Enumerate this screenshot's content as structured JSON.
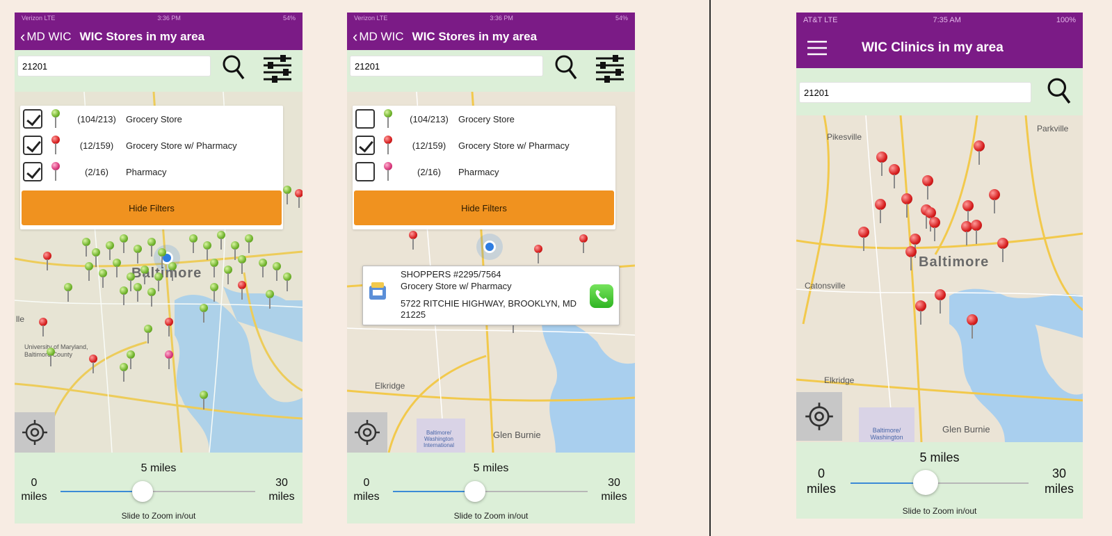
{
  "phone1": {
    "status": {
      "carrier": "Verizon LTE",
      "time": "3:36 PM",
      "battery": "54%"
    },
    "nav": {
      "back_label": "MD WIC",
      "title": "WIC Stores in my area"
    },
    "search": {
      "value": "21201"
    },
    "filters": [
      {
        "count": "(104/213)",
        "label": "Grocery Store",
        "checked": true,
        "pin": "green"
      },
      {
        "count": "(12/159)",
        "label": "Grocery Store w/ Pharmacy",
        "checked": true,
        "pin": "red"
      },
      {
        "count": "(2/16)",
        "label": "Pharmacy",
        "checked": true,
        "pin": "pink"
      }
    ],
    "hide_filters": "Hide Filters",
    "map": {
      "city": "Baltimore",
      "labels": [
        "lle",
        "University of Maryland, Baltimore County"
      ]
    },
    "zoom": {
      "value": "5 miles",
      "min": "0",
      "min_unit": "miles",
      "max": "30",
      "max_unit": "miles",
      "hint": "Slide to Zoom in/out",
      "level": 5
    }
  },
  "phone2": {
    "status": {
      "carrier": "Verizon LTE",
      "time": "3:36 PM",
      "battery": "54%"
    },
    "nav": {
      "back_label": "MD WIC",
      "title": "WIC Stores in my area"
    },
    "search": {
      "value": "21201"
    },
    "filters": [
      {
        "count": "(104/213)",
        "label": "Grocery Store",
        "checked": false,
        "pin": "green"
      },
      {
        "count": "(12/159)",
        "label": "Grocery Store w/ Pharmacy",
        "checked": true,
        "pin": "red"
      },
      {
        "count": "(2/16)",
        "label": "Pharmacy",
        "checked": false,
        "pin": "pink"
      }
    ],
    "hide_filters": "Hide Filters",
    "popup": {
      "store": "SHOPPERS #2295/7564",
      "type": "Grocery Store w/ Pharmacy",
      "address": "5722 RITCHIE HIGHWAY, BROOKLYN, MD 21225"
    },
    "map": {
      "labels": [
        "Elkridge",
        "Glen Burnie",
        "Baltimore/ Washington International"
      ]
    },
    "zoom": {
      "value": "5 miles",
      "min": "0",
      "min_unit": "miles",
      "max": "30",
      "max_unit": "miles",
      "hint": "Slide to Zoom in/out",
      "level": 5
    }
  },
  "phone3": {
    "status": {
      "carrier": "AT&T LTE",
      "time": "7:35 AM",
      "battery": "100%"
    },
    "nav": {
      "title": "WIC Clinics in my area"
    },
    "search": {
      "value": "21201"
    },
    "map": {
      "city": "Baltimore",
      "labels": [
        "Pikesville",
        "Parkville",
        "Catonsville",
        "Elkridge",
        "Glen Burnie",
        "Baltimore/ Washington"
      ]
    },
    "zoom": {
      "value": "5 miles",
      "min": "0",
      "min_unit": "miles",
      "max": "30",
      "max_unit": "miles",
      "hint": "Slide to Zoom in/out",
      "level": 5
    }
  },
  "colors": {
    "header": "#7b1b86",
    "accent": "#f0921f",
    "panel": "#dcefd8"
  }
}
